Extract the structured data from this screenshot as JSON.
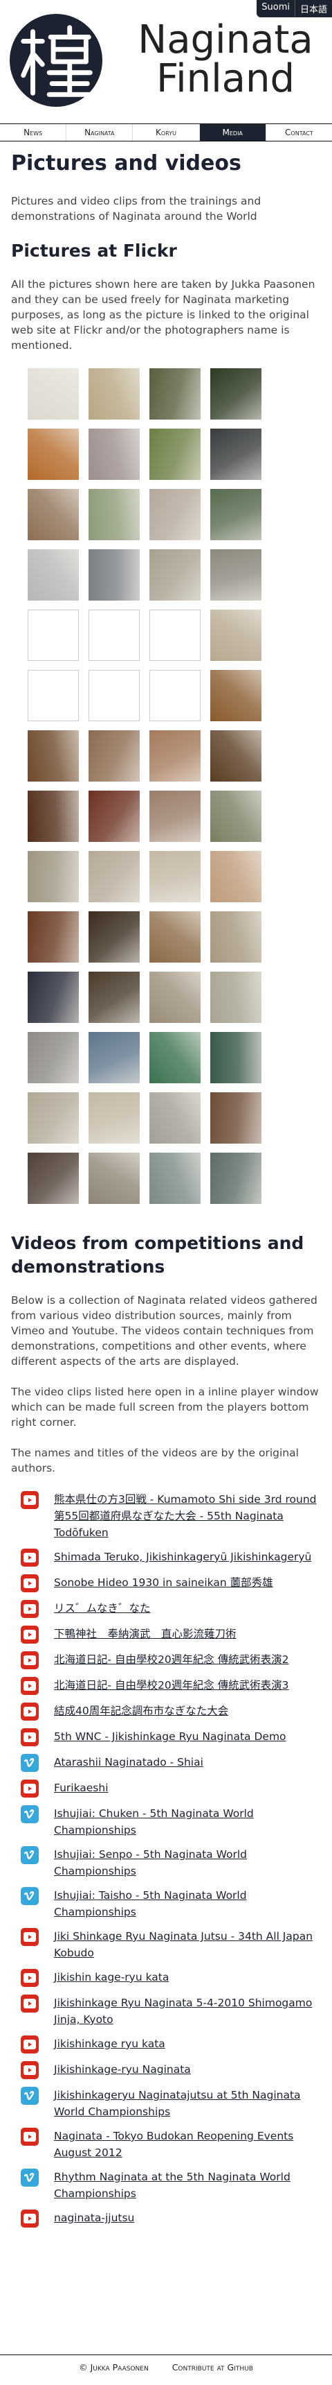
{
  "lang": {
    "fi": "Suomi",
    "ja": "日本語"
  },
  "brand": {
    "line1": "Naginata",
    "line2": "Finland"
  },
  "nav": [
    "News",
    "Naginata",
    "Koryu",
    "Media",
    "Contact"
  ],
  "page_title": "Pictures and videos",
  "intro": "Pictures and video clips from the trainings and demonstrations of Naginata around the World",
  "flickr": {
    "heading": "Pictures at Flickr",
    "text": "All the pictures shown here are taken by Jukka Paasonen and they can be used freely for Naginata marketing purposes, as long as the picture is linked to the original web site at Flickr and/or the photographers name is mentioned."
  },
  "photos": [
    "#dcd9cf",
    "#b8a784",
    "#5b5f3f",
    "#2d3a22",
    "#b56a2a",
    "#9c8f8e",
    "#6d7f44",
    "#3a3d3f",
    "#8d7055",
    "#8d9b79",
    "#b4a89b",
    "#596b50",
    "#b5b7b5",
    "#7b7f84",
    "#a8a08f",
    "#8c8a7e",
    "blank",
    "blank",
    "blank",
    "#b7a890",
    "blank",
    "blank",
    "blank",
    "#8a5b2e",
    "#6e4a2b",
    "#8c6b50",
    "#a57a5b",
    "#5a3d23",
    "#54301c",
    "#6c3122",
    "#9a7e6a",
    "#7a7f63",
    "#9f9582",
    "#b6a997",
    "#c5b9a6",
    "#bf9b7a",
    "#6a3a22",
    "#3b2c1e",
    "#8c6b47",
    "#a69880",
    "#2a2d3a",
    "#4a3c2c",
    "#9a8d79",
    "#a8a391",
    "#8e8b86",
    "#60778c",
    "#3b7350",
    "#3a5a48",
    "#b2a897",
    "#c4b9a5",
    "#a39f95",
    "#6f4d38",
    "#4f3f36",
    "#8e8575",
    "#7b8a84",
    "#5d6d66"
  ],
  "videos": {
    "heading": "Videos from competitions and demonstrations",
    "text1": "Below is a collection of Naginata related videos gathered from various video distribution sources, mainly from Vimeo and Youtube. The videos contain techniques from demonstrations, competitions and other events, where different aspects of the arts are displayed.",
    "text2": "The video clips listed here open in a inline player window which can be made full screen from the players bottom right corner.",
    "text3": "The names and titles of the videos are by the original authors.",
    "items": [
      {
        "src": "yt",
        "title": "熊本県仕の方3回戦 - Kumamoto Shi side 3rd round 第55回都道府県なぎなた大会 - 55th Naginata Todōfuken"
      },
      {
        "src": "yt",
        "title": "Shimada Teruko, Jikishinkageryū Jikishinkageryū"
      },
      {
        "src": "yt",
        "title": "Sonobe Hideo 1930 in saineikan 薗部秀雄"
      },
      {
        "src": "yt",
        "title": "リス゛ムなき゛なた"
      },
      {
        "src": "yt",
        "title": "下鴨神社　奉納演武　直心影流薙刀術"
      },
      {
        "src": "yt",
        "title": "北海道日記- 自由學校20週年紀念 傳統武術表演2"
      },
      {
        "src": "yt",
        "title": "北海道日記- 自由學校20週年紀念 傳統武術表演3"
      },
      {
        "src": "yt",
        "title": "結成40周年記念調布市なぎなた大会"
      },
      {
        "src": "yt",
        "title": "5th WNC - Jikishinkage Ryu Naginata Demo"
      },
      {
        "src": "vm",
        "title": "Atarashii Naginatado - Shiai"
      },
      {
        "src": "yt",
        "title": "Furikaeshi"
      },
      {
        "src": "vm",
        "title": "Ishujiai: Chuken - 5th Naginata World Championships"
      },
      {
        "src": "vm",
        "title": "Ishujiai: Senpo - 5th Naginata World Championships"
      },
      {
        "src": "vm",
        "title": "Ishujiai: Taisho - 5th Naginata World Championships"
      },
      {
        "src": "yt",
        "title": "Jiki Shinkage Ryu Naginata Jutsu - 34th All Japan Kobudo"
      },
      {
        "src": "yt",
        "title": "Jikishin kage-ryu kata"
      },
      {
        "src": "yt",
        "title": "Jikishinkage Ryu Naginata 5-4-2010 Shimogamo Jinja, Kyoto"
      },
      {
        "src": "yt",
        "title": "Jikishinkage ryu kata"
      },
      {
        "src": "yt",
        "title": "Jikishinkage-ryu Naginata"
      },
      {
        "src": "vm",
        "title": "Jikishinkageryu Naginatajutsu at 5th Naginata World Championships"
      },
      {
        "src": "yt",
        "title": "Naginata - Tokyo Budokan Reopening Events August 2012"
      },
      {
        "src": "vm",
        "title": "Rhythm Naginata at the 5th Naginata World Championships"
      },
      {
        "src": "yt",
        "title": "naginata-jjutsu"
      }
    ]
  },
  "footer": {
    "copyright": "© Jukka Paasonen",
    "contribute": "Contribute at Github"
  }
}
